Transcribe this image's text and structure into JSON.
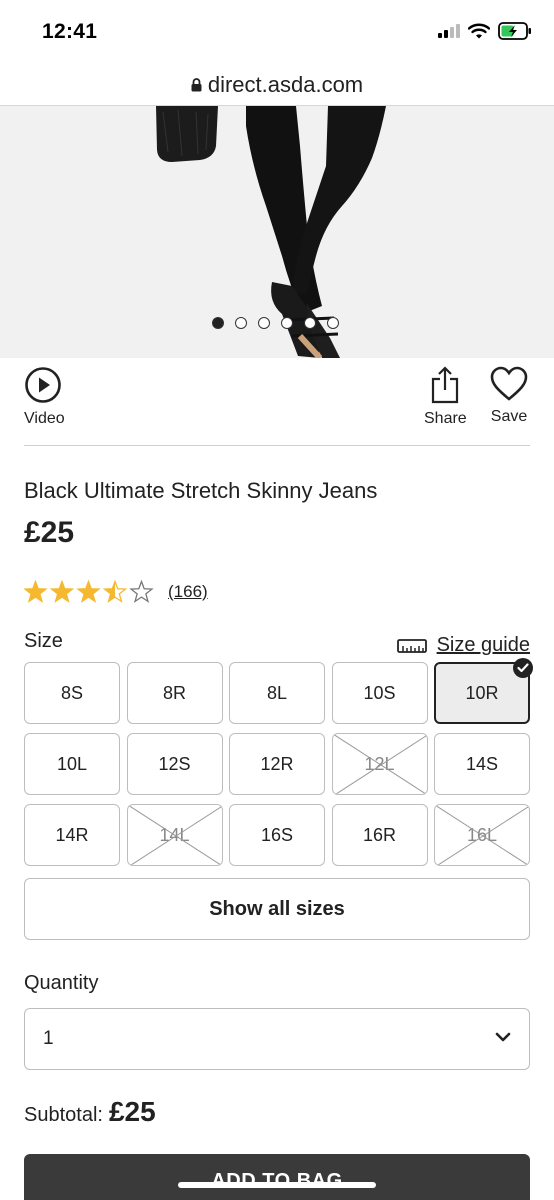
{
  "status_bar": {
    "time": "12:41"
  },
  "browser": {
    "url": "direct.asda.com"
  },
  "gallery": {
    "slide_count": 6,
    "active_index": 0
  },
  "actions": {
    "video_label": "Video",
    "share_label": "Share",
    "save_label": "Save"
  },
  "product": {
    "title": "Black Ultimate Stretch Skinny Jeans",
    "price": "£25",
    "rating": 3.5,
    "rating_max": 5,
    "review_count": "(166)"
  },
  "size": {
    "label": "Size",
    "guide_label": "Size guide",
    "options": [
      {
        "label": "8S",
        "available": true
      },
      {
        "label": "8R",
        "available": true
      },
      {
        "label": "8L",
        "available": true
      },
      {
        "label": "10S",
        "available": true
      },
      {
        "label": "10R",
        "available": true,
        "selected": true
      },
      {
        "label": "10L",
        "available": true
      },
      {
        "label": "12S",
        "available": true
      },
      {
        "label": "12R",
        "available": true
      },
      {
        "label": "12L",
        "available": false
      },
      {
        "label": "14S",
        "available": true
      },
      {
        "label": "14R",
        "available": true
      },
      {
        "label": "14L",
        "available": false
      },
      {
        "label": "16S",
        "available": true
      },
      {
        "label": "16R",
        "available": true
      },
      {
        "label": "16L",
        "available": false
      }
    ],
    "show_all_label": "Show all sizes"
  },
  "quantity": {
    "label": "Quantity",
    "value": "1"
  },
  "subtotal": {
    "label": "Subtotal:",
    "value": "£25"
  },
  "cta": {
    "add_to_bag_label": "ADD TO BAG"
  },
  "colors": {
    "star": "#f5b82e",
    "button_dark": "#3a3a3a",
    "selected_bg": "#ececec"
  }
}
